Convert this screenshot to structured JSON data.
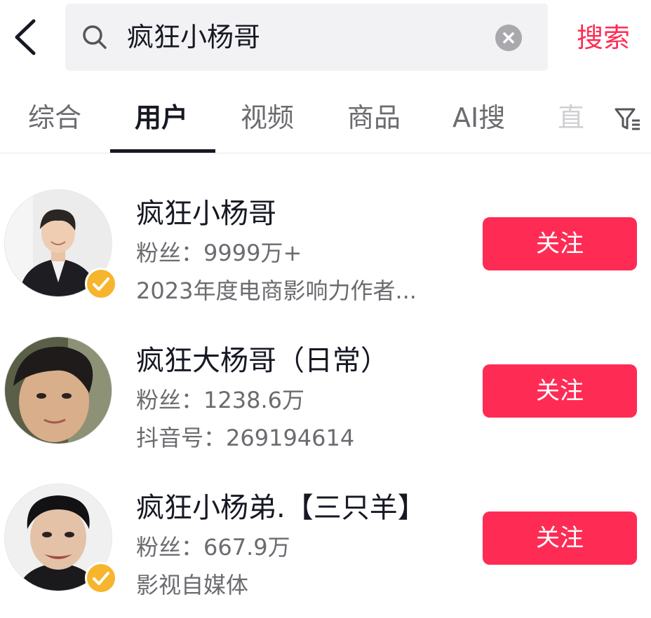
{
  "header": {
    "back_icon": "chevron-left-icon",
    "search_icon": "search-icon",
    "query": "疯狂小杨哥",
    "clear_icon": "clear-icon",
    "search_button": "搜索"
  },
  "tabs": [
    {
      "label": "综合",
      "active": false
    },
    {
      "label": "用户",
      "active": true
    },
    {
      "label": "视频",
      "active": false
    },
    {
      "label": "商品",
      "active": false
    },
    {
      "label": "AI搜",
      "active": false
    },
    {
      "label": "直",
      "active": false
    }
  ],
  "filter_icon": "filter-icon",
  "users": [
    {
      "name": "疯狂小杨哥",
      "followers": "粉丝：9999万+",
      "detail": "2023年度电商影响力作者...",
      "verified": true,
      "follow_label": "关注"
    },
    {
      "name": "疯狂大杨哥（日常）",
      "followers": "粉丝：1238.6万",
      "detail": "抖音号：269194614",
      "verified": false,
      "follow_label": "关注"
    },
    {
      "name": "疯狂小杨弟.【三只羊】",
      "followers": "粉丝：667.9万",
      "detail": "影视自媒体",
      "verified": true,
      "follow_label": "关注"
    }
  ],
  "colors": {
    "accent": "#fe2c55",
    "verified": "#f7b52e",
    "text": "#161823",
    "secondary": "#6b6b70"
  }
}
